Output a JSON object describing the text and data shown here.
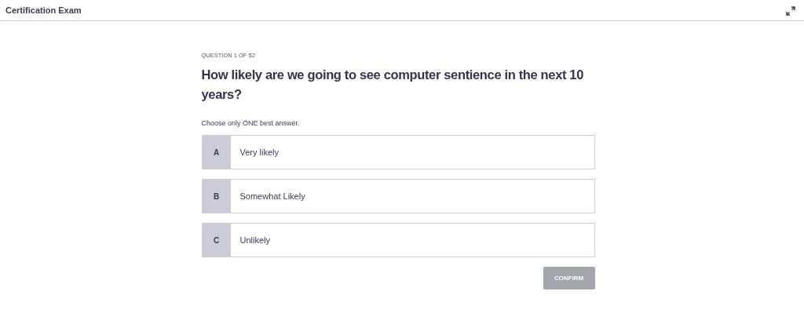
{
  "header": {
    "title": "Certification Exam"
  },
  "question": {
    "counter": "QUESTION 1 OF 52",
    "text": "How likely are we going to see computer sentience in the next 10 years?",
    "instruction": "Choose only ONE best answer."
  },
  "options": [
    {
      "letter": "A",
      "label": "Very likely",
      "selected": false
    },
    {
      "letter": "B",
      "label": "Somewhat Likely",
      "selected": false
    },
    {
      "letter": "C",
      "label": "Unlikely",
      "selected": false
    }
  ],
  "confirm": {
    "label": "CONFIRM",
    "disabled": true
  }
}
